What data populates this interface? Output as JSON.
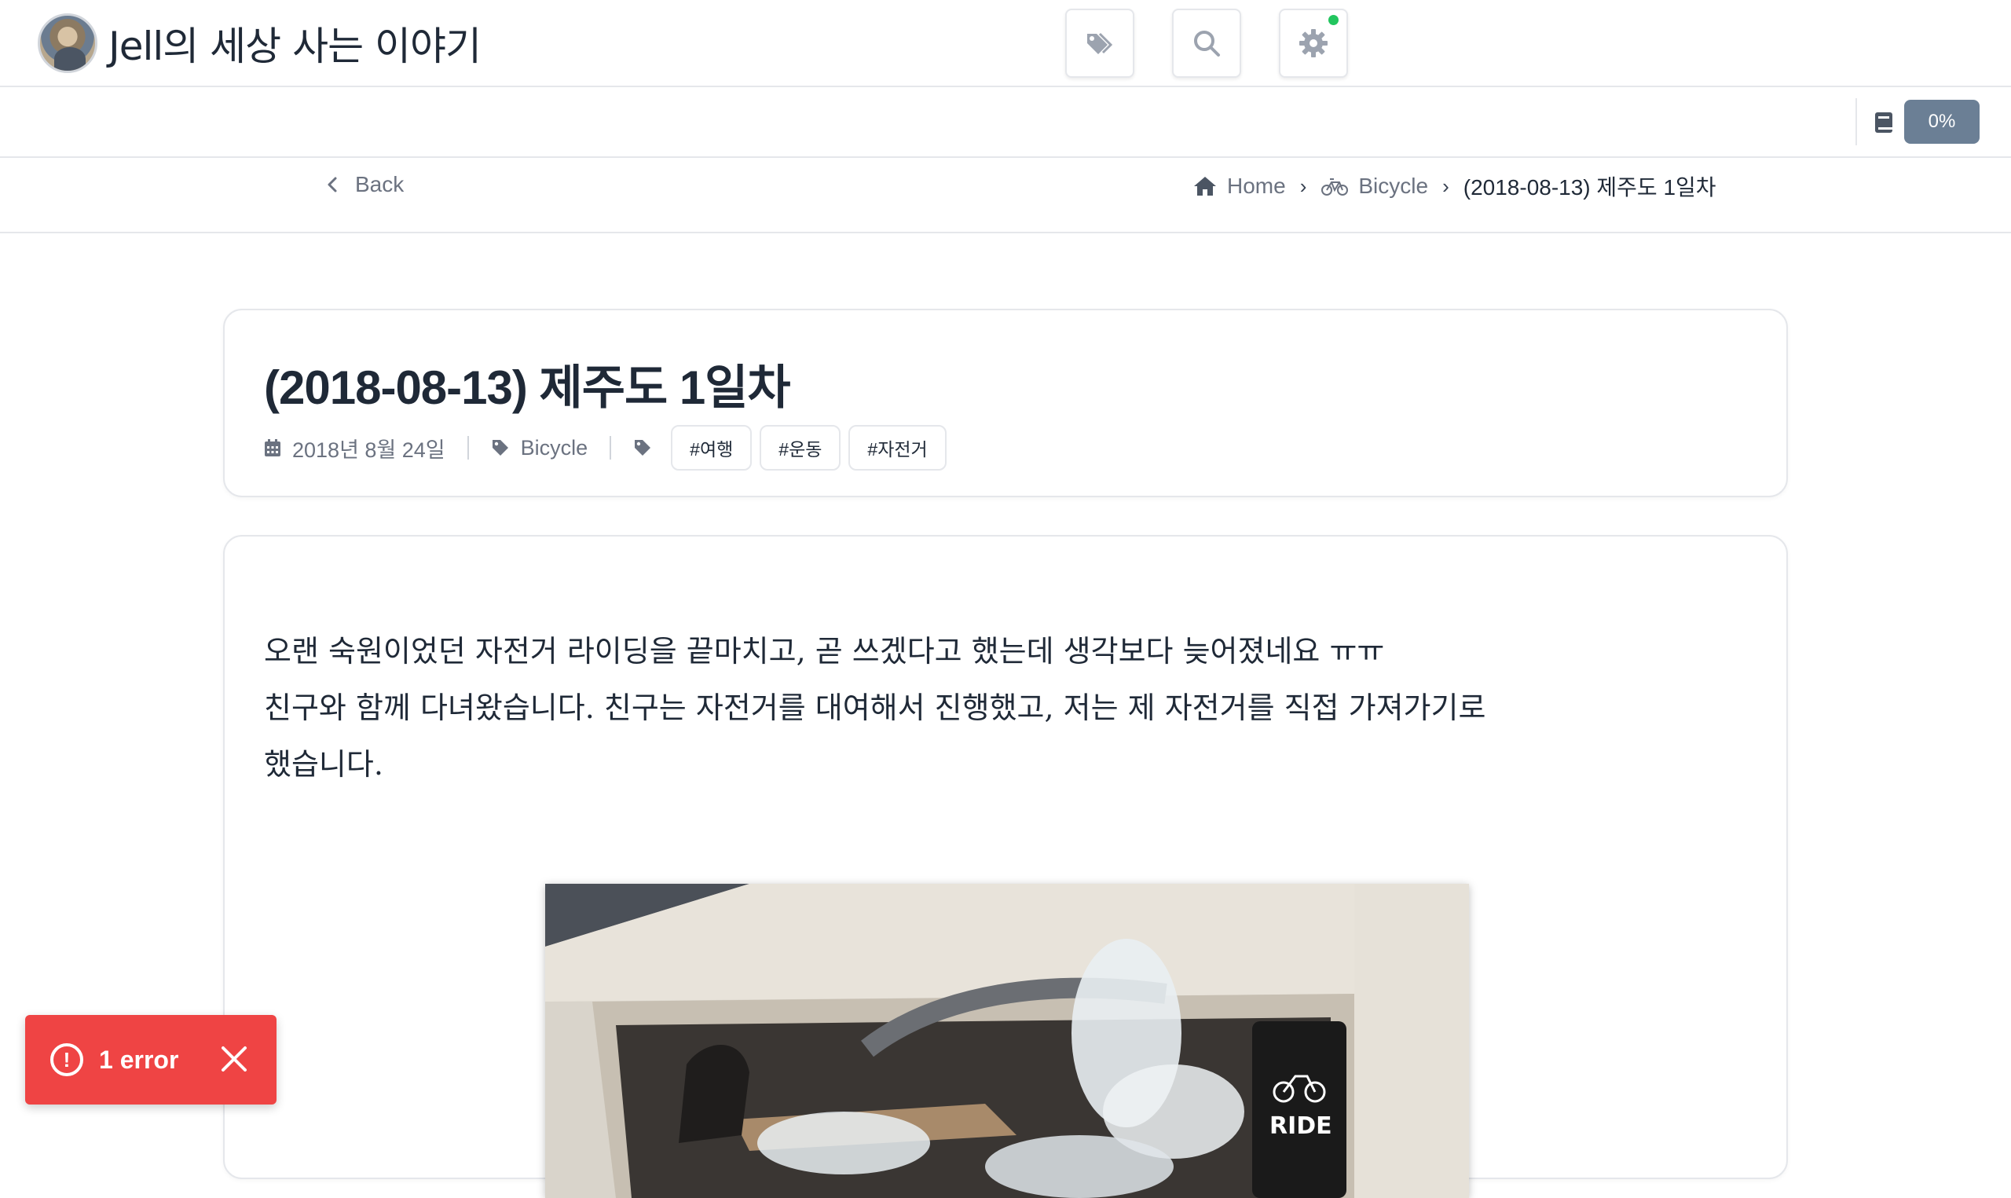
{
  "header": {
    "site_title": "Jell의 세상 사는 이야기",
    "buttons": [
      {
        "name": "tags-icon"
      },
      {
        "name": "search-icon"
      },
      {
        "name": "settings-icon"
      }
    ],
    "status_dot_color": "#22c55e"
  },
  "progress": {
    "percent_label": "0%"
  },
  "nav": {
    "back_label": "Back",
    "breadcrumb": {
      "home": "Home",
      "category": "Bicycle",
      "current": "(2018-08-13) 제주도 1일차"
    }
  },
  "post": {
    "title": "(2018-08-13) 제주도 1일차",
    "date": "2018년 8월 24일",
    "category": "Bicycle",
    "tags": [
      "#여행",
      "#운동",
      "#자전거"
    ],
    "paragraph_lines": [
      "오랜 숙원이었던 자전거 라이딩을 끝마치고, 곧 쓰겠다고 했는데 생각보다 늦어졌네요 ㅠㅠ",
      "친구와 함께 다녀왔습니다. 친구는 자전거를 대여해서 진행했고, 저는 제 자전거를 직접 가져가기로",
      "했습니다."
    ],
    "photo_text": "RIDE"
  },
  "toast": {
    "message": "1 error",
    "color": "#ef4444"
  }
}
